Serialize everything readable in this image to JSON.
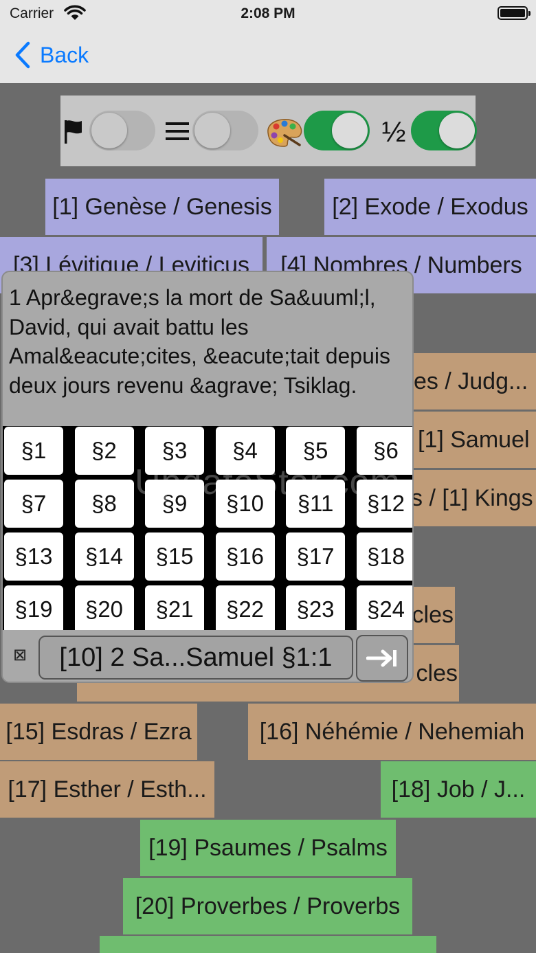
{
  "status": {
    "carrier": "Carrier",
    "time": "2:08 PM"
  },
  "nav": {
    "back_label": "Back"
  },
  "toolbar": {
    "half_label": "½"
  },
  "books": [
    {
      "label": "[1] Genèse / Genesis"
    },
    {
      "label": "[2] Exode / Exodus"
    },
    {
      "label": "[3] Lévitique / Leviticus"
    },
    {
      "label": "[4] Nombres / Numbers"
    },
    {
      "label": "es / Judg..."
    },
    {
      "label": "[1] Samuel"
    },
    {
      "label": "s / [1] Kings"
    },
    {
      "label": "cles"
    },
    {
      "label": "cles"
    },
    {
      "label": "[15] Esdras / Ezra"
    },
    {
      "label": "[16] Néhémie / Nehemiah"
    },
    {
      "label": "[17] Esther / Esth..."
    },
    {
      "label": "[18] Job / J..."
    },
    {
      "label": "[19] Psaumes / Psalms"
    },
    {
      "label": "[20] Proverbes / Proverbs"
    }
  ],
  "popup": {
    "verse_text": "1 Apr&egrave;s la mort de Sa&uuml;l, David, qui avait battu les Amal&eacute;cites, &eacute;tait depuis deux jours revenu &agrave; Tsiklag.",
    "verses": [
      "§1",
      "§2",
      "§3",
      "§4",
      "§5",
      "§6",
      "§7",
      "§8",
      "§9",
      "§10",
      "§11",
      "§12",
      "§13",
      "§14",
      "§15",
      "§16",
      "§17",
      "§18",
      "§19",
      "§20",
      "§21",
      "§22",
      "§23",
      "§24"
    ],
    "clear_glyph": "⊠",
    "location": "[10] 2 Sa...Samuel §1:1"
  },
  "watermark": "UpdateStar.com",
  "icons": {
    "flag": "flag-icon",
    "list": "list-icon",
    "palette": "palette-icon",
    "go": "arrow-right-to-bar-icon",
    "back": "chevron-left-icon"
  }
}
